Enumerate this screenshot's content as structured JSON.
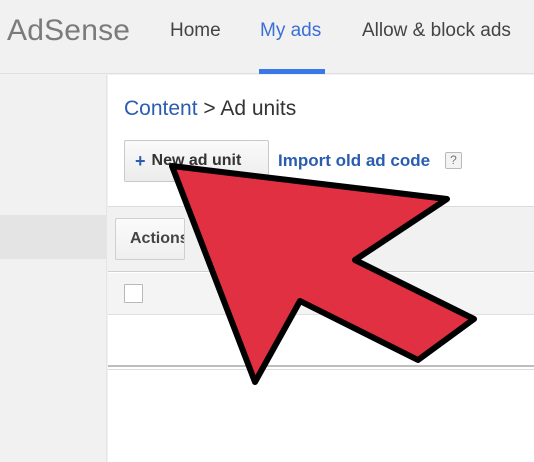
{
  "header": {
    "logo": "AdSense",
    "tabs": [
      {
        "label": "Home",
        "active": false
      },
      {
        "label": "My ads",
        "active": true
      },
      {
        "label": "Allow & block ads",
        "active": false
      }
    ]
  },
  "breadcrumb": {
    "parent": "Content",
    "separator": ">",
    "current": "Ad units"
  },
  "toolbar": {
    "new_ad_unit_plus": "+",
    "new_ad_unit_label": "New ad unit",
    "import_label": "Import old ad code",
    "help_icon": "?"
  },
  "table": {
    "actions_label": "Actions"
  },
  "colors": {
    "link_blue": "#2a5db0",
    "active_tab_blue": "#3b78e7",
    "arrow_red": "#e03041"
  },
  "icons": [
    "plus-icon",
    "help-icon",
    "red-arrow-annotation"
  ]
}
